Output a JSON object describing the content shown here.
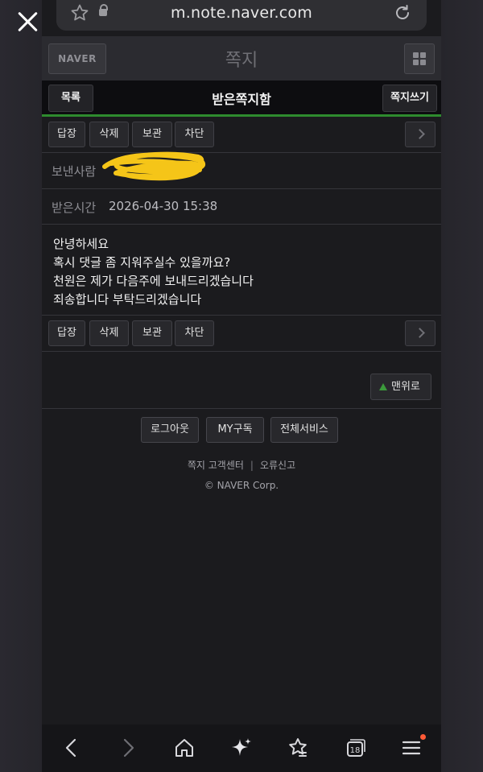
{
  "browser": {
    "url": "m.note.naver.com"
  },
  "app": {
    "logo": "NAVER",
    "title": "쪽지"
  },
  "mailbar": {
    "list_label": "목록",
    "title": "받은쪽지함",
    "write_label": "쪽지쓰기"
  },
  "toolbar": {
    "reply": "답장",
    "delete": "삭제",
    "keep": "보관",
    "block": "차단"
  },
  "message": {
    "sender_label": "보낸사람",
    "received_label": "받은시간",
    "received_time": "2026-04-30 15:38",
    "body_lines": [
      "안녕하세요",
      "혹시 댓글 좀 지워주실수 있을까요?",
      "천원은 제가 다음주에 보내드리겠습니다",
      "죄송합니다 부탁드리겠습니다"
    ]
  },
  "scroll_top_label": "맨위로",
  "footer": {
    "logout": "로그아웃",
    "my_subscribe": "MY구독",
    "all_services": "전체서비스",
    "help": "쪽지 고객센터",
    "separator": "|",
    "report": "오류신고",
    "copyright": "© NAVER Corp."
  },
  "bottom_nav": {
    "tabs_count": "18"
  },
  "colors": {
    "accent_green": "#2e8b2e",
    "background": "#1b1b1e",
    "redaction": "#f5c518",
    "notification_dot": "#ff5a36"
  }
}
